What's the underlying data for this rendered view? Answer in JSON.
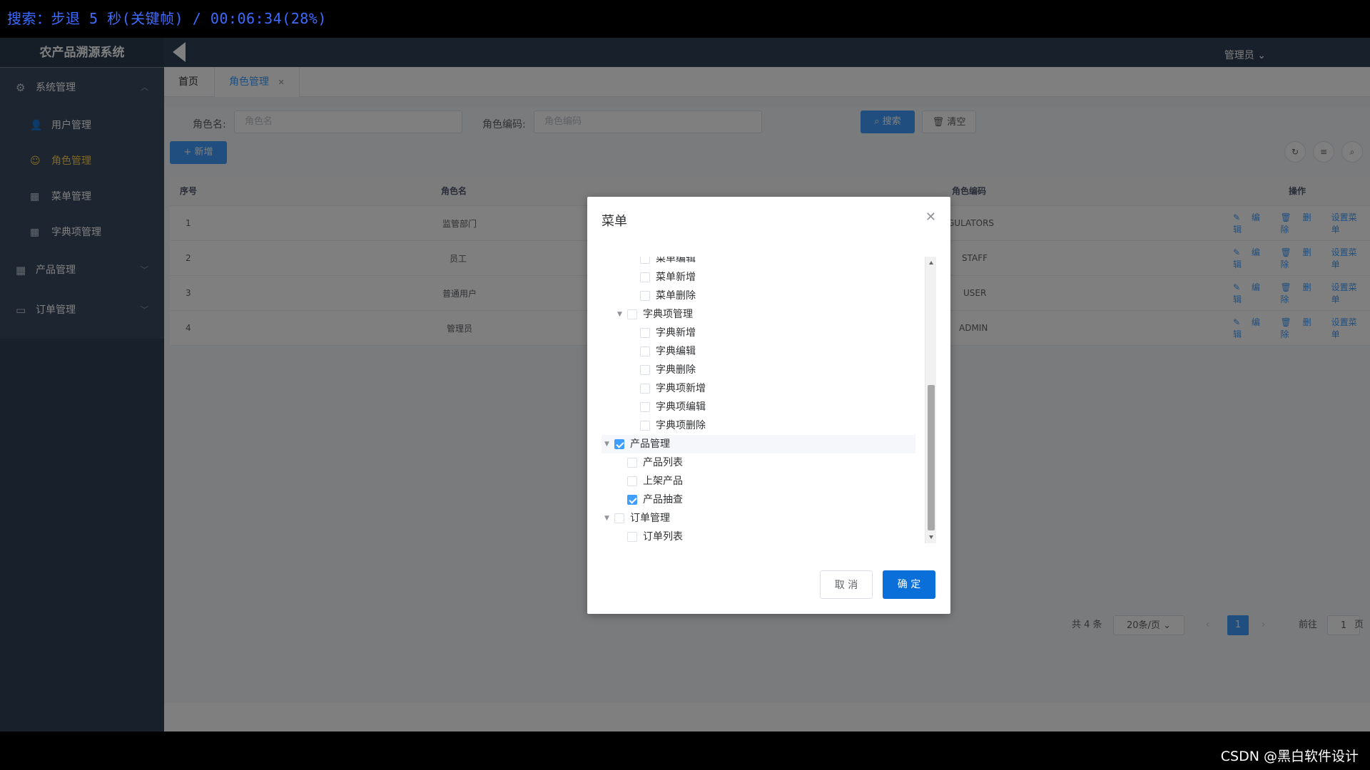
{
  "overlay": {
    "search_text": "搜索：步退 5 秒(关键帧) / 00:06:34(28%)"
  },
  "sidebar": {
    "brand": "农产品溯源系统",
    "groups": [
      {
        "label": "系统管理",
        "icon": "gear-icon"
      },
      {
        "label": "产品管理",
        "icon": "grid-icon"
      },
      {
        "label": "订单管理",
        "icon": "briefcase-icon"
      }
    ],
    "items": [
      {
        "label": "用户管理",
        "icon": "user-icon"
      },
      {
        "label": "角色管理",
        "icon": "user-outline-icon"
      },
      {
        "label": "菜单管理",
        "icon": "grid-icon"
      },
      {
        "label": "字典项管理",
        "icon": "grid-icon"
      }
    ]
  },
  "header": {
    "user": "管理员"
  },
  "tabs": [
    {
      "label": "首页"
    },
    {
      "label": "角色管理"
    }
  ],
  "search": {
    "name_label": "角色名:",
    "name_placeholder": "角色名",
    "code_label": "角色编码:",
    "code_placeholder": "角色编码",
    "search_btn": "搜索",
    "clear_btn": "清空",
    "add_btn": "+ 新增"
  },
  "table": {
    "headers": {
      "index": "序号",
      "name": "角色名",
      "code": "角色编码",
      "ops": "操作"
    },
    "rows": [
      {
        "index": "1",
        "name": "监管部门",
        "code": "GULATORS"
      },
      {
        "index": "2",
        "name": "员工",
        "code": "STAFF"
      },
      {
        "index": "3",
        "name": "普通用户",
        "code": "USER"
      },
      {
        "index": "4",
        "name": "管理员",
        "code": "ADMIN"
      }
    ],
    "ops": {
      "edit": "编辑",
      "delete": "删除",
      "menu": "设置菜单"
    }
  },
  "pager": {
    "total": "共 4 条",
    "size": "20条/页",
    "page": "1",
    "goto": "前往",
    "goto_value": "1",
    "page_unit": "页"
  },
  "dialog": {
    "title": "菜单",
    "cancel": "取 消",
    "ok": "确 定",
    "tree": [
      {
        "label": "菜单编辑",
        "level": 3,
        "checked": false,
        "caret": "none"
      },
      {
        "label": "菜单新增",
        "level": 3,
        "checked": false,
        "caret": "none"
      },
      {
        "label": "菜单删除",
        "level": 3,
        "checked": false,
        "caret": "none"
      },
      {
        "label": "字典项管理",
        "level": 2,
        "checked": false,
        "caret": "open"
      },
      {
        "label": "字典新增",
        "level": 3,
        "checked": false,
        "caret": "none"
      },
      {
        "label": "字典编辑",
        "level": 3,
        "checked": false,
        "caret": "none"
      },
      {
        "label": "字典删除",
        "level": 3,
        "checked": false,
        "caret": "none"
      },
      {
        "label": "字典项新增",
        "level": 3,
        "checked": false,
        "caret": "none"
      },
      {
        "label": "字典项编辑",
        "level": 3,
        "checked": false,
        "caret": "none"
      },
      {
        "label": "字典项删除",
        "level": 3,
        "checked": false,
        "caret": "none"
      },
      {
        "label": "产品管理",
        "level": 1,
        "checked": true,
        "caret": "open"
      },
      {
        "label": "产品列表",
        "level": 2,
        "checked": false,
        "caret": "none"
      },
      {
        "label": "上架产品",
        "level": 2,
        "checked": false,
        "caret": "none"
      },
      {
        "label": "产品抽查",
        "level": 2,
        "checked": true,
        "caret": "none"
      },
      {
        "label": "订单管理",
        "level": 1,
        "checked": false,
        "caret": "open"
      },
      {
        "label": "订单列表",
        "level": 2,
        "checked": false,
        "caret": "none"
      }
    ]
  },
  "watermark": "CSDN @黑白软件设计"
}
